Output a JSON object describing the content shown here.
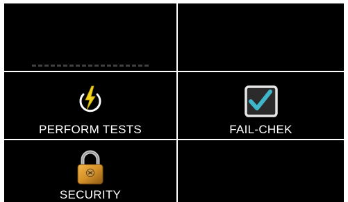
{
  "tiles": [
    {
      "id": "top-left",
      "label": ""
    },
    {
      "id": "top-right",
      "label": ""
    },
    {
      "id": "perform-tests",
      "label": "PERFORM TESTS",
      "icon": "power-bolt-icon"
    },
    {
      "id": "fail-chek",
      "label": "FAIL-CHEK",
      "icon": "checkbox-checked-icon"
    },
    {
      "id": "security",
      "label": "SECURITY",
      "icon": "padlock-icon"
    },
    {
      "id": "bottom-right",
      "label": ""
    }
  ],
  "colors": {
    "background": "#000000",
    "grid_lines": "#ffffff",
    "label": "#ffffff",
    "bolt": "#f2d21b",
    "check": "#3fb6c9",
    "padlock": "#d4912a"
  }
}
